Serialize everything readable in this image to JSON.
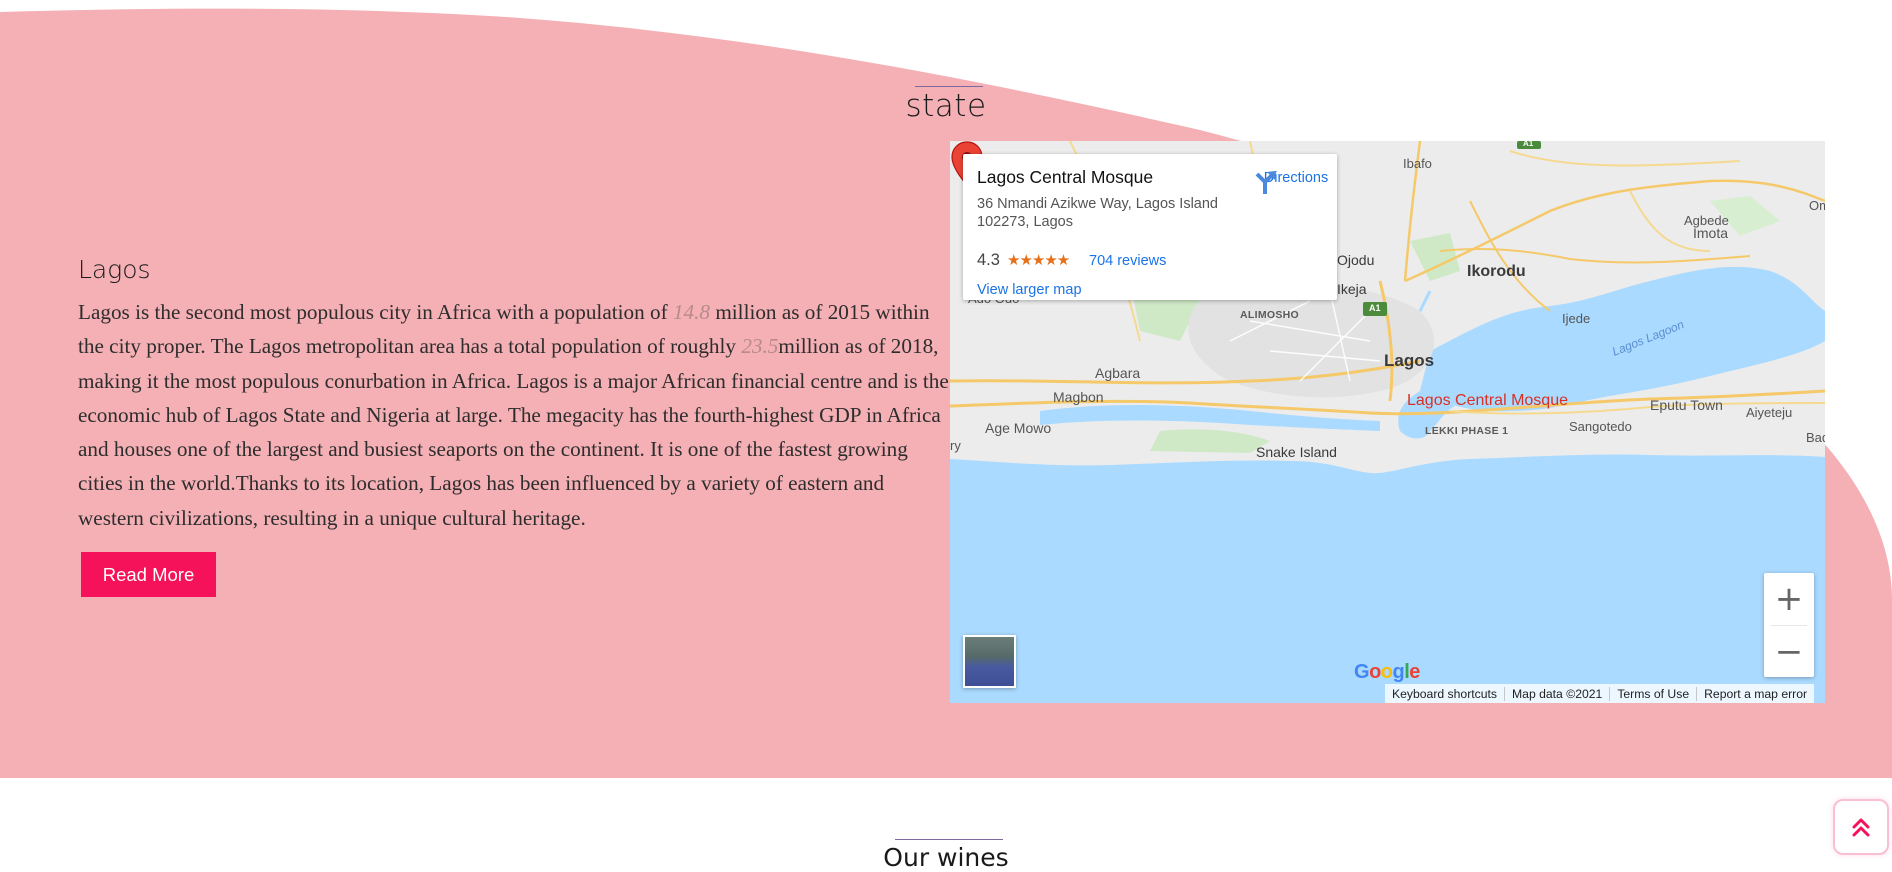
{
  "section": {
    "title": "state"
  },
  "city": {
    "name": "Lagos",
    "description": {
      "part1": "Lagos is the second most populous city in Africa with a population of ",
      "stat1": "14.8",
      "part2": " million as of 2015 within the city proper. The Lagos metropolitan area has a total population of roughly ",
      "stat2": "23.5",
      "part3": "million as of 2018, making it the most populous conurbation in Africa. Lagos is a major African financial centre and is the economic hub of Lagos State and Nigeria at large. The megacity has the fourth-highest GDP in Africa and houses one of the largest and busiest seaports on the continent. It is one of the fastest growing cities in the world.Thanks to its location, Lagos has been influenced by a variety of eastern and western civilizations, resulting in a unique cultural heritage."
    },
    "read_more_label": "Read More"
  },
  "map": {
    "place_name": "Lagos Central Mosque",
    "address": "36 Nmandi Azikwe Way, Lagos Island 102273, Lagos",
    "rating": "4.3",
    "stars": "★★★★★",
    "reviews_label": "704 reviews",
    "larger_map_label": "View larger map",
    "directions_label": "Directions",
    "pin_label": "Lagos Central Mosque",
    "labels": {
      "ibafo": "Ibafo",
      "agbede": "Agbede",
      "imota": "Imota",
      "om": "Om",
      "ojodu": "Ojodu",
      "ikeja": "Ikeja",
      "ikorodu": "Ikorodu",
      "ado_odo": "Ado Odo",
      "alimosho": "ALIMOSHO",
      "ijede": "Ijede",
      "lagos_lagoon": "Lagos Lagoon",
      "lagos": "Lagos",
      "agbara": "Agbara",
      "magbon": "Magbon",
      "eputu_town": "Eputu Town",
      "aiyeteju": "Aiyeteju",
      "age_mowo": "Age Mowo",
      "lekki_phase": "LEKKI PHASE 1",
      "sangotedo": "Sangotedo",
      "bad": "Bad",
      "ry": "ry",
      "snake_island": "Snake Island",
      "a1_north": "A1",
      "a1_ikeja": "A1"
    },
    "zoom_in": "+",
    "zoom_out": "−",
    "google_logo": "Google",
    "footer": {
      "shortcuts": "Keyboard shortcuts",
      "map_data": "Map data ©2021",
      "terms": "Terms of Use",
      "report": "Report a map error"
    }
  },
  "next_section": {
    "title": "Our wines"
  },
  "colors": {
    "background_blob": "#f4b0b5",
    "accent": "#f5125b",
    "map_water": "#aadaff",
    "map_land": "#ececec",
    "pin": "#d93025",
    "link": "#1a73e8"
  },
  "icons": {
    "directions": "directions-arrow-icon",
    "pin": "map-pin-icon",
    "scroll_top": "double-chevron-up-icon"
  }
}
